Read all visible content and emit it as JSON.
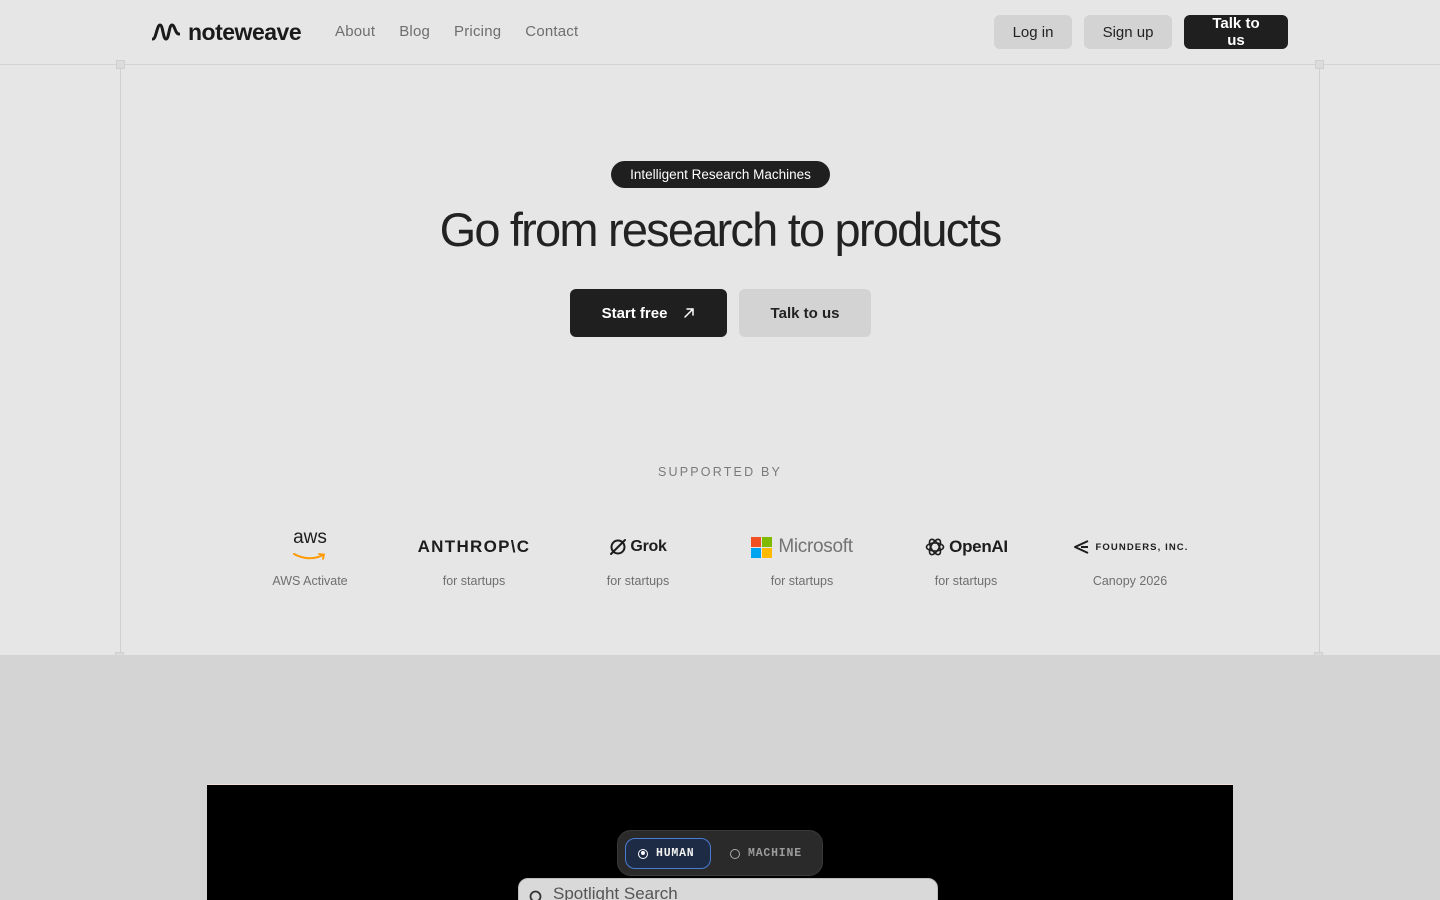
{
  "brand": {
    "name": "noteweave"
  },
  "nav": {
    "items": [
      "About",
      "Blog",
      "Pricing",
      "Contact"
    ]
  },
  "header_buttons": {
    "login": "Log in",
    "signup": "Sign up",
    "talk": "Talk to us"
  },
  "hero": {
    "badge": "Intelligent Research Machines",
    "headline": "Go from research to products",
    "primary_cta": "Start free",
    "secondary_cta": "Talk to us"
  },
  "supporters": {
    "heading": "SUPPORTED BY",
    "items": [
      {
        "name": "aws",
        "caption": "AWS Activate",
        "icon": "aws-logo"
      },
      {
        "name": "ANTHROP\\C",
        "caption": "for startups",
        "icon": "anthropic-logo"
      },
      {
        "name": "Grok",
        "caption": "for startups",
        "icon": "grok-logo"
      },
      {
        "name": "Microsoft",
        "caption": "for startups",
        "icon": "microsoft-logo"
      },
      {
        "name": "OpenAI",
        "caption": "for startups",
        "icon": "openai-logo"
      },
      {
        "name": "FOUNDERS, INC.",
        "caption": "Canopy 2026",
        "icon": "founders-inc-logo"
      }
    ]
  },
  "demo": {
    "toggle": {
      "human": "HUMAN",
      "machine": "MACHINE",
      "selected": "HUMAN"
    },
    "search": {
      "placeholder": "Spotlight Search"
    }
  },
  "colors": {
    "background": "#e6e6e6",
    "dark": "#1f1f1f",
    "button_grey": "#d3d3d3",
    "toggle_active_border": "#4a7bd0",
    "ms_red": "#f25022",
    "ms_green": "#7fba00",
    "ms_blue": "#00a4ef",
    "ms_yellow": "#ffb900",
    "aws_orange": "#ff9900"
  }
}
